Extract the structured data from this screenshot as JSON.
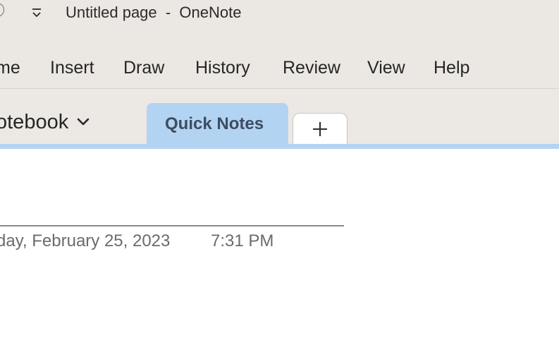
{
  "window": {
    "title": "Untitled page  -  OneNote"
  },
  "ribbon": {
    "tabs": [
      {
        "label": "me"
      },
      {
        "label": "Insert"
      },
      {
        "label": "Draw"
      },
      {
        "label": "History"
      },
      {
        "label": "Review"
      },
      {
        "label": "View"
      },
      {
        "label": "Help"
      }
    ]
  },
  "notebook": {
    "name": "otebook",
    "chevron_icon": "chevron-down-icon"
  },
  "sections": {
    "active": "Quick Notes",
    "add_icon": "plus-icon"
  },
  "page": {
    "date": "day, February 25, 2023",
    "time": "7:31 PM"
  },
  "colors": {
    "chrome_background": "#ebe7e2",
    "section_active": "#b3d3f3",
    "section_label": "#3d4c60",
    "meta_text": "#6b6b6b"
  }
}
